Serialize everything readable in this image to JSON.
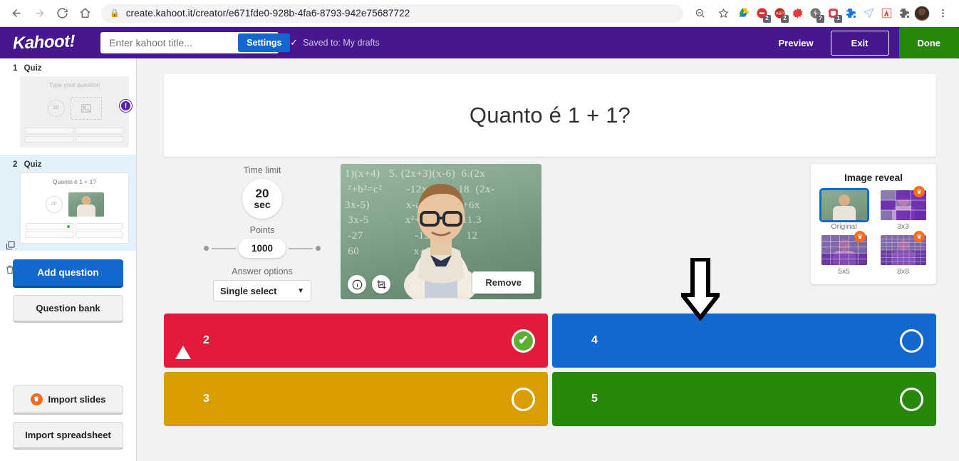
{
  "browser": {
    "back_icon": "back-arrow-icon",
    "forward_icon": "forward-arrow-icon",
    "reload_icon": "reload-icon",
    "home_icon": "home-icon",
    "lock_icon": "lock-icon",
    "url": "create.kahoot.it/creator/e671fde0-928b-4fa6-8793-942e75687722",
    "zoom_icon": "zoom-out-icon",
    "star_icon": "bookmark-star-icon",
    "extensions": [
      {
        "name": "google-drive-extension",
        "glyph": "▲",
        "color": "#2BA24C",
        "badge": ""
      },
      {
        "name": "adblock-extension",
        "glyph": "●",
        "color": "#D32F2F",
        "badge": "2"
      },
      {
        "name": "adblock-plus-extension",
        "glyph": "●",
        "color": "#C62828",
        "badge": "2"
      },
      {
        "name": "honey-extension",
        "glyph": "✷",
        "color": "#E53935",
        "badge": ""
      },
      {
        "name": "user-agent-extension",
        "glyph": "●",
        "color": "#757575",
        "badge": "?"
      },
      {
        "name": "loom-extension",
        "glyph": "▣",
        "color": "#E8384F",
        "badge": "1"
      },
      {
        "name": "puzzle-blue-extension",
        "glyph": "✚",
        "color": "#1A73E8",
        "badge": ""
      },
      {
        "name": "paper-plane-extension",
        "glyph": "✈",
        "color": "#9FC7E8",
        "badge": ""
      },
      {
        "name": "adobe-acrobat-extension",
        "glyph": "⅄",
        "color": "#D64A3B",
        "badge": ""
      },
      {
        "name": "extensions-puzzle-icon",
        "glyph": "✚",
        "color": "#5f6368",
        "badge": ""
      }
    ],
    "profile_icon": "profile-avatar",
    "menu_icon": "chrome-menu-icon"
  },
  "header": {
    "logo": "Kahoot!",
    "title_placeholder": "Enter kahoot title...",
    "title_value": "",
    "settings_label": "Settings",
    "saved_status": "Saved to: My drafts",
    "check_glyph": "✓",
    "preview_label": "Preview",
    "exit_label": "Exit",
    "done_label": "Done",
    "accent_purple": "#46178F",
    "accent_blue": "#1368CE",
    "accent_green": "#26890C"
  },
  "sidebar": {
    "slides": [
      {
        "number": "1",
        "type": "Quiz",
        "question_placeholder": "Type your question",
        "timer": "20",
        "selected": false,
        "has_warning": true,
        "warning_glyph": "!",
        "image_icon": "image-placeholder-icon"
      },
      {
        "number": "2",
        "type": "Quiz",
        "question": "Quanto é 1 + 1?",
        "timer": "20",
        "selected": true,
        "has_warning": false
      }
    ],
    "tools": {
      "duplicate_icon": "duplicate-slide-icon",
      "delete_icon": "trash-icon"
    },
    "add_question_label": "Add question",
    "question_bank_label": "Question bank",
    "import_slides_label": "Import slides",
    "import_slides_icon": "crown-premium-icon",
    "import_spreadsheet_label": "Import spreadsheet"
  },
  "main": {
    "question": "Quanto é 1 + 1?",
    "time_limit_label": "Time limit",
    "time_limit_value": "20",
    "time_limit_unit": "sec",
    "points_label": "Points",
    "points_value": "1000",
    "answer_options_label": "Answer options",
    "answer_options_value": "Single select",
    "caret_glyph": "▼",
    "media": {
      "info_icon": "info-icon",
      "crop_icon": "crop-image-icon",
      "remove_label": "Remove",
      "chalkboard_text": "1)(x+4)   5. (2x+3)(x-6)  6.(2x\n ²+b²=c²        -12x + 3x -18  (2x-\n3x-5)            x-ay   8. 3x²+6x\n 3x-5            x²+13x+30  11.3\n -27                 -15 = 0      12\n 60                  x+3)"
    },
    "reveal": {
      "title": "Image reveal",
      "options": [
        {
          "label": "Original",
          "selected": true,
          "premium": false
        },
        {
          "label": "3x3",
          "selected": false,
          "premium": true,
          "grid": 3
        },
        {
          "label": "5x5",
          "selected": false,
          "premium": true,
          "grid": 5
        },
        {
          "label": "8x8",
          "selected": false,
          "premium": true,
          "grid": 8
        }
      ],
      "crown_glyph": "♛"
    },
    "answers": [
      {
        "text": "2",
        "color": "red",
        "hex": "#E21B3C",
        "shape": "triangle",
        "correct": true,
        "mark_glyph": "✔"
      },
      {
        "text": "4",
        "color": "blue",
        "hex": "#1368CE",
        "shape": "diamond",
        "correct": false,
        "mark_glyph": ""
      },
      {
        "text": "3",
        "color": "yellow",
        "hex": "#D89E00",
        "shape": "circle",
        "correct": false,
        "mark_glyph": ""
      },
      {
        "text": "5",
        "color": "green",
        "hex": "#26890C",
        "shape": "square",
        "correct": false,
        "mark_glyph": ""
      }
    ]
  }
}
